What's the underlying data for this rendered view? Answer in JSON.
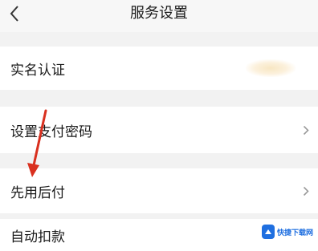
{
  "header": {
    "title": "服务设置",
    "back_icon": "chevron-left-icon"
  },
  "rows": [
    {
      "label": "实名认证",
      "has_chevron": false
    },
    {
      "label": "设置支付密码",
      "has_chevron": true
    },
    {
      "label": "先用后付",
      "has_chevron": true
    },
    {
      "label": "自动扣款",
      "has_chevron": false
    }
  ],
  "annotation": {
    "type": "arrow",
    "color": "#d9301f"
  },
  "watermark": {
    "text": "快捷下载网"
  }
}
